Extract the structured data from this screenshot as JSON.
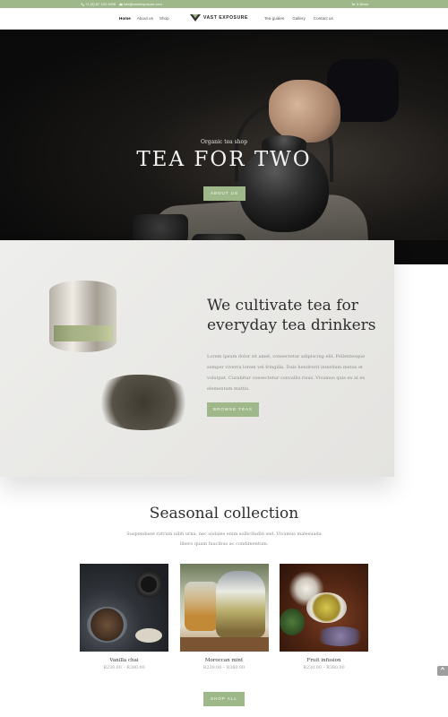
{
  "topbar": {
    "phone": "+1 (0) 87 120 1098",
    "email": "info@vastexposure.com",
    "cart_label": "0 Items"
  },
  "nav": {
    "left_items": [
      {
        "label": "Home",
        "active": true
      },
      {
        "label": "About us",
        "active": false
      },
      {
        "label": "Shop",
        "active": false
      }
    ],
    "logo_text": "VAST EXPOSURE",
    "right_items": [
      {
        "label": "Tea guides"
      },
      {
        "label": "Gallery"
      },
      {
        "label": "Contact us"
      }
    ]
  },
  "hero": {
    "subtitle": "Organic tea shop",
    "title": "TEA FOR TWO",
    "button_label": "ABOUT US"
  },
  "intro": {
    "heading": "We cultivate tea for everyday tea drinkers",
    "body": "Lorem ipsum dolor sit amet, consectetur adipiscing elit. Pellentesque semper viverra lorem vel fringilla. Duis hendrerit interdum metus et volutpat. Curabitur consectetur convallis risus. Vivamus quis ex at ex elementum mattis.",
    "button_label": "BROWSE TEAS"
  },
  "seasonal": {
    "title": "Seasonal collection",
    "description": "Suspendisse rutrum nibh urna, nec sodales enim sollicitudin sed. Vivamus malesuada libero quam faucibus ac condimentum.",
    "products": [
      {
        "name": "Vanilla chai",
        "price": "R230.00 – R380.00"
      },
      {
        "name": "Moroccan mint",
        "price": "R230.00 – R380.00"
      },
      {
        "name": "Fruit infusion",
        "price": "R230.00 – R380.00"
      }
    ],
    "button_label": "SHOP ALL"
  },
  "scroll_top": {
    "icon": "chevron-up-icon"
  },
  "colors": {
    "accent": "#9fb889",
    "hero_bg": "#0b0b0b",
    "text_dark": "#2e2e2e"
  }
}
